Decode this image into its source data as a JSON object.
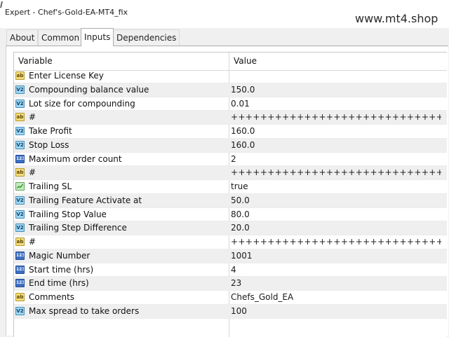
{
  "window": {
    "title": "Expert - Chef's-Gold-EA-MT4_fix",
    "watermark": "www.mt4.shop"
  },
  "tabs": [
    {
      "label": "About",
      "active": false
    },
    {
      "label": "Common",
      "active": false
    },
    {
      "label": "Inputs",
      "active": true
    },
    {
      "label": "Dependencies",
      "active": false
    }
  ],
  "table": {
    "headers": {
      "variable": "Variable",
      "value": "Value"
    },
    "rows": [
      {
        "icon": "string-type-icon",
        "name": "Enter License Key",
        "value": ""
      },
      {
        "icon": "double-type-icon",
        "name": "Compounding balance value",
        "value": "150.0"
      },
      {
        "icon": "double-type-icon",
        "name": "Lot size for compounding",
        "value": "0.01"
      },
      {
        "icon": "string-type-icon",
        "name": "#",
        "value": "++++++++++++++++++++++++++++++++++++++++"
      },
      {
        "icon": "double-type-icon",
        "name": "Take Profit",
        "value": "160.0"
      },
      {
        "icon": "double-type-icon",
        "name": "Stop Loss",
        "value": "160.0"
      },
      {
        "icon": "integer-type-icon",
        "name": "Maximum order count",
        "value": "2"
      },
      {
        "icon": "string-type-icon",
        "name": "#",
        "value": "++++++++++++++++++++++++++++++++++++++++"
      },
      {
        "icon": "bool-type-icon",
        "name": "Trailing SL",
        "value": "true"
      },
      {
        "icon": "double-type-icon",
        "name": "Trailing Feature Activate at",
        "value": "50.0"
      },
      {
        "icon": "double-type-icon",
        "name": "Trailing Stop Value",
        "value": "80.0"
      },
      {
        "icon": "double-type-icon",
        "name": "Trailing Step Difference",
        "value": "20.0"
      },
      {
        "icon": "string-type-icon",
        "name": "#",
        "value": "++++++++++++++++++++++++++++++++++++++++"
      },
      {
        "icon": "integer-type-icon",
        "name": "Magic Number",
        "value": "1001"
      },
      {
        "icon": "integer-type-icon",
        "name": "Start time (hrs)",
        "value": "4"
      },
      {
        "icon": "integer-type-icon",
        "name": "End time (hrs)",
        "value": "23"
      },
      {
        "icon": "string-type-icon",
        "name": "Comments",
        "value": "Chefs_Gold_EA"
      },
      {
        "icon": "double-type-icon",
        "name": "Max spread to take orders",
        "value": "100"
      }
    ]
  },
  "icon_glyphs": {
    "string-type-icon": "ab",
    "double-type-icon": "V2",
    "integer-type-icon": "123"
  },
  "colors": {
    "row_alt": "#efefef",
    "row_base": "#ffffff",
    "window_bg": "#f0f0f0"
  }
}
